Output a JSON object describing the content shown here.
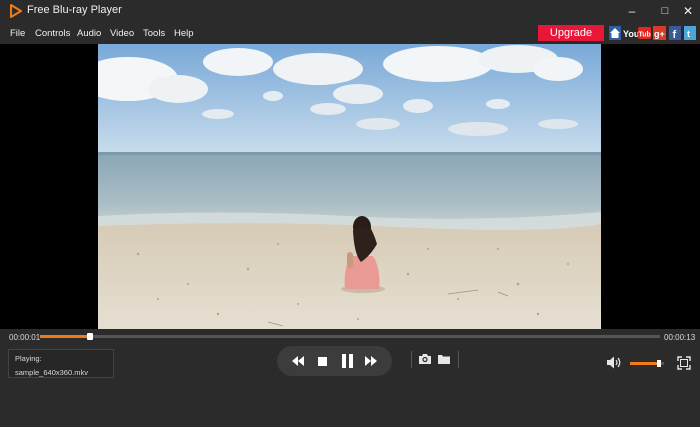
{
  "app": {
    "title": "Free Blu-ray Player"
  },
  "window_controls": {
    "minimize": "–",
    "maximize": "□",
    "close": "✕"
  },
  "menu": [
    "File",
    "Controls",
    "Audio",
    "Video",
    "Tools",
    "Help"
  ],
  "upgrade_label": "Upgrade",
  "social": {
    "youtube_label": "You Tube",
    "gplus_label": "g+"
  },
  "playback": {
    "current_time": "00:00:01",
    "total_time": "00:00:13",
    "progress": 0.08,
    "volume": 0.85
  },
  "playing": {
    "label": "Playing:",
    "file": "sample_640x360.mkv"
  },
  "colors": {
    "accent": "#f07c18",
    "upgrade": "#e8173a",
    "background": "#2b2b2b"
  },
  "icons": [
    "play-logo-icon",
    "home-icon",
    "youtube-icon",
    "google-plus-icon",
    "facebook-icon",
    "twitter-icon",
    "rewind-icon",
    "stop-icon",
    "pause-icon",
    "fast-forward-icon",
    "camera-icon",
    "folder-icon",
    "volume-icon",
    "fullscreen-icon"
  ]
}
